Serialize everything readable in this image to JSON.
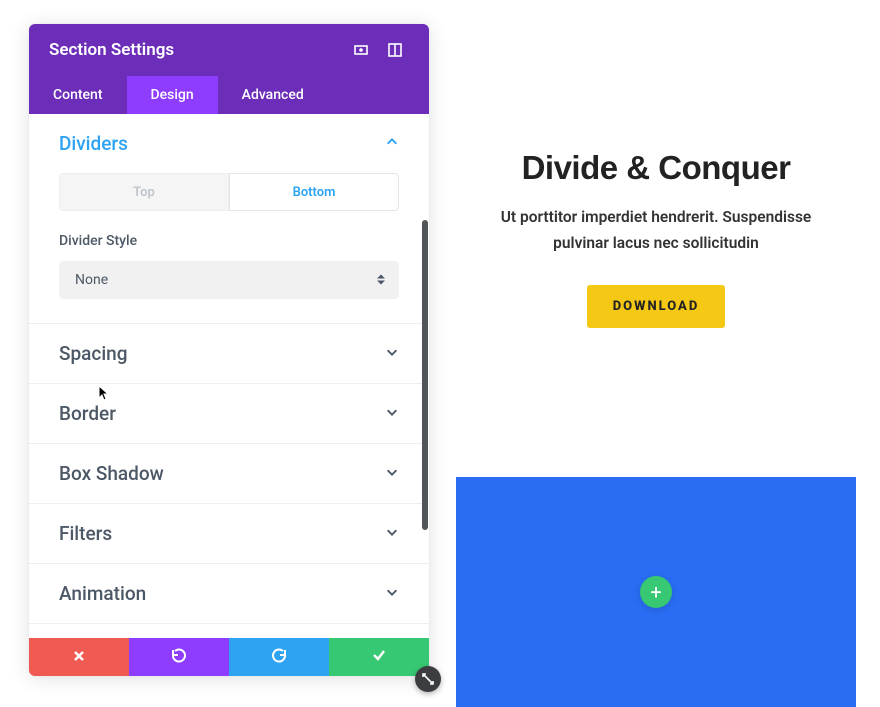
{
  "panel": {
    "title": "Section Settings",
    "tabs": [
      "Content",
      "Design",
      "Advanced"
    ],
    "active_tab_index": 1
  },
  "dividers": {
    "title": "Dividers",
    "toggle": {
      "top": "Top",
      "bottom": "Bottom",
      "active": "bottom"
    },
    "style_label": "Divider Style",
    "style_value": "None"
  },
  "accordions": {
    "spacing": "Spacing",
    "border": "Border",
    "box_shadow": "Box Shadow",
    "filters": "Filters",
    "animation": "Animation"
  },
  "preview": {
    "heading": "Divide & Conquer",
    "text": "Ut porttitor imperdiet hendrerit. Suspendisse pulvinar lacus nec sollicitudin",
    "button": "DOWNLOAD"
  },
  "icons": {
    "plus": "+"
  }
}
